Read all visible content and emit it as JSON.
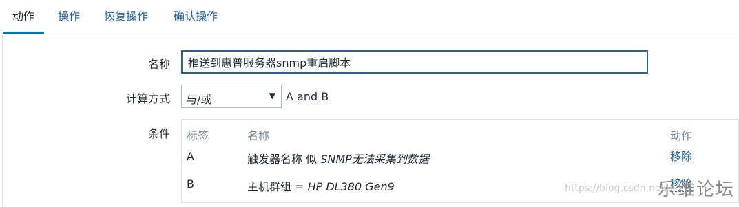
{
  "tabs": [
    {
      "label": "动作",
      "active": true
    },
    {
      "label": "操作",
      "active": false
    },
    {
      "label": "恢复操作",
      "active": false
    },
    {
      "label": "确认操作",
      "active": false
    }
  ],
  "form": {
    "name_label": "名称",
    "name_value": "推送到惠普服务器snmp重启脚本",
    "calc_label": "计算方式",
    "calc_selected": "与/或",
    "calc_expression": "A and B",
    "conditions_label": "条件"
  },
  "conditions": {
    "headers": {
      "tag": "标签",
      "name": "名称",
      "action": "动作"
    },
    "rows": [
      {
        "tag": "A",
        "name_prefix": "触发器名称 似 ",
        "name_value": "SNMP无法采集到数据",
        "action": "移除"
      },
      {
        "tag": "B",
        "name_prefix": "主机群组 = ",
        "name_value": "HP DL380 Gen9",
        "action": "移除"
      }
    ]
  },
  "watermark": {
    "url": "https://blog.csdn.net/...",
    "site": "乐维论坛"
  },
  "colors": {
    "accent": "#0275b8",
    "link": "#1f65a6",
    "border": "#dfe4e7"
  }
}
